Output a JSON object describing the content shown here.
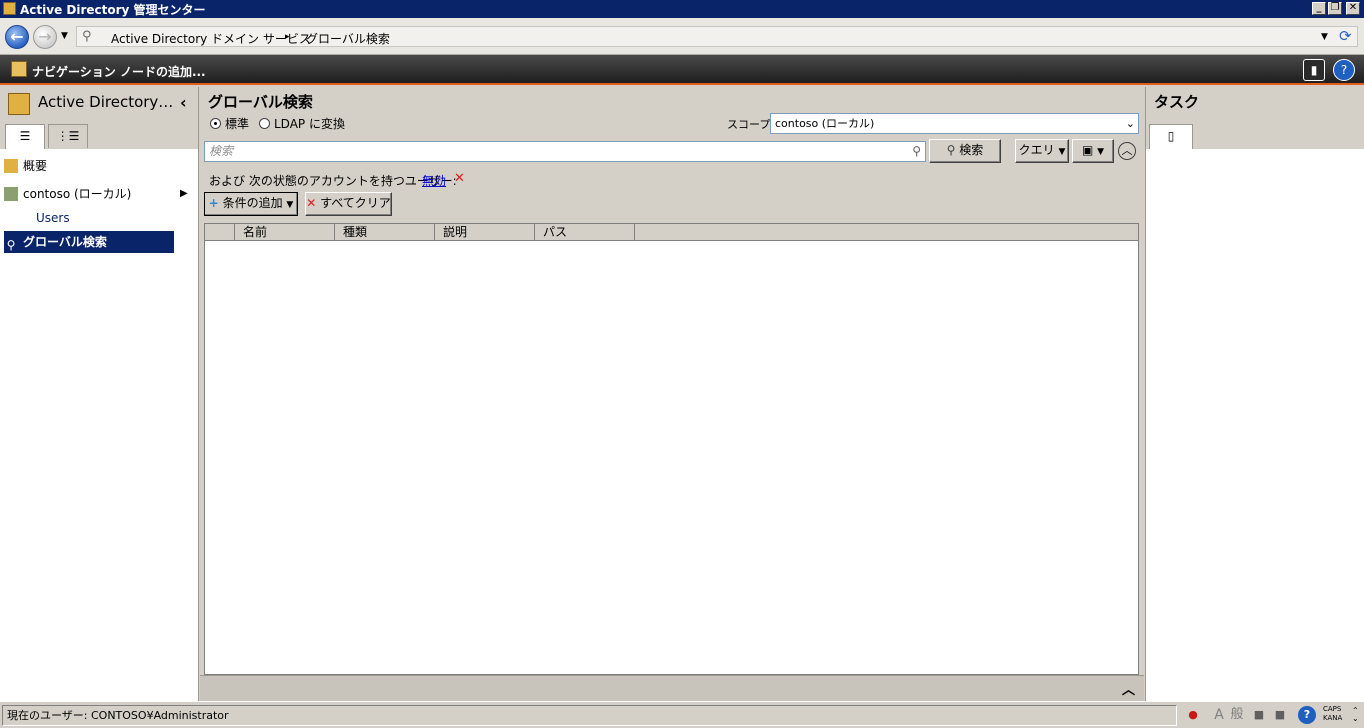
{
  "window": {
    "title": "Active Directory 管理センター",
    "controls": [
      "minimize",
      "restore",
      "close"
    ]
  },
  "address_bar": {
    "crumbs": [
      "Active Directory ドメイン サービス",
      "グローバル検索"
    ],
    "separator": "▸"
  },
  "toolbar": {
    "add_navigation_node": "ナビゲーション ノードの追加..."
  },
  "left_pane": {
    "title": "Active Directory…",
    "collapse_glyph": "‹",
    "tabs": [
      {
        "icon": "list-view-icon"
      },
      {
        "icon": "tree-view-icon"
      }
    ],
    "items": [
      {
        "label": "概要",
        "icon": "overview-icon"
      },
      {
        "label": "contoso (ローカル)",
        "icon": "domain-icon"
      },
      {
        "label": "Users"
      },
      {
        "label": "グローバル検索",
        "icon": "search-icon",
        "selected": true
      }
    ]
  },
  "center": {
    "title": "グローバル検索",
    "mode_standard": "標準",
    "mode_ldap": "LDAP に変換",
    "scope_label": "スコープ:",
    "scope_value": "contoso (ローカル)",
    "search_placeholder": "検索",
    "search_button": "検索",
    "query_button": "クエリ",
    "criteria_text": "および 次の状態のアカウントを持つユーザー:",
    "criteria_link": "無効",
    "add_criteria": "条件の追加",
    "clear_all": "すべてクリア",
    "columns": [
      "名前",
      "種類",
      "説明",
      "パス"
    ]
  },
  "right_pane": {
    "title": "タスク"
  },
  "status": {
    "current_user": "現在のユーザー: CONTOSO¥Administrator",
    "ime_mode": "般",
    "ime_a": "A",
    "caps": "CAPS",
    "kana": "KANA"
  },
  "colors": {
    "titlebar": "#0a246a",
    "selection": "#0a246a",
    "accent_line": "#e25a1c",
    "link": "#0000cc",
    "delete_red": "#d81e1e"
  }
}
